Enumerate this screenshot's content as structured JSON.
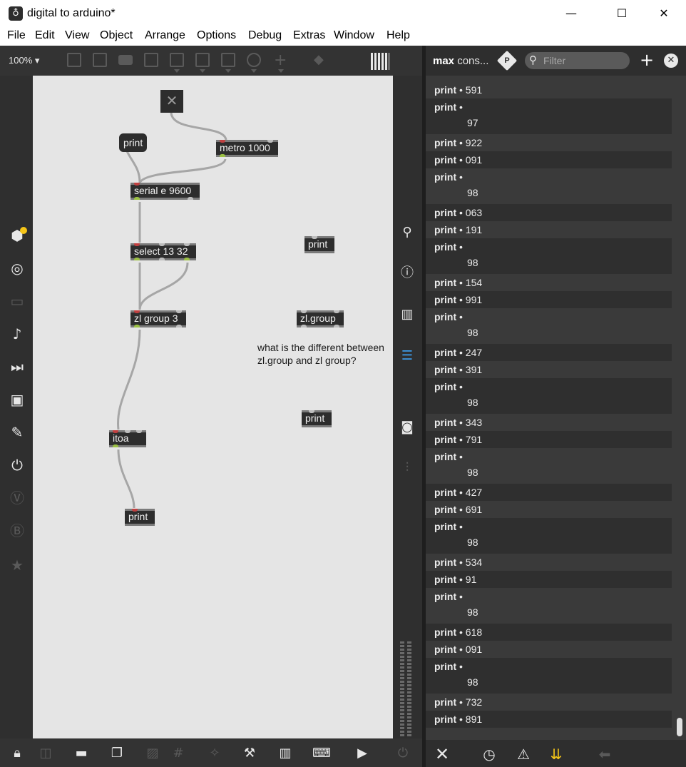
{
  "window": {
    "title": "digital to arduino*",
    "controls": {
      "minimize": "—",
      "maximize": "☐",
      "close": "✕"
    }
  },
  "menu": [
    "File",
    "Edit",
    "View",
    "Object",
    "Arrange",
    "Options",
    "Debug",
    "Extras",
    "Window",
    "Help"
  ],
  "toolbar": {
    "zoom": "100% ▾"
  },
  "patcher": {
    "objects": {
      "metro": "metro 1000",
      "serial": "serial e 9600",
      "select": "select 13 32",
      "zlgroup3": "zl group 3",
      "itoa": "itoa",
      "zlgroup": "zl.group"
    },
    "messages": {
      "print_msg": "print"
    },
    "print_objects": [
      "print",
      "print",
      "print"
    ],
    "comment": "what is the different between zl.group and zl group?"
  },
  "console": {
    "title_bold": "max",
    "title_rest": " cons...",
    "filter_placeholder": "Filter",
    "rows": [
      {
        "src": "print",
        "sep": " • ",
        "val": "591",
        "two": false
      },
      {
        "src": "print",
        "sep": " •",
        "val": "97",
        "two": true
      },
      {
        "src": "print",
        "sep": " • ",
        "val": "922",
        "two": false
      },
      {
        "src": "print",
        "sep": " • ",
        "val": "091",
        "two": false
      },
      {
        "src": "print",
        "sep": " •",
        "val": "98",
        "two": true
      },
      {
        "src": "print",
        "sep": " • ",
        "val": "063",
        "two": false
      },
      {
        "src": "print",
        "sep": " • ",
        "val": "191",
        "two": false
      },
      {
        "src": "print",
        "sep": " •",
        "val": "98",
        "two": true
      },
      {
        "src": "print",
        "sep": " • ",
        "val": "154",
        "two": false
      },
      {
        "src": "print",
        "sep": " • ",
        "val": "991",
        "two": false
      },
      {
        "src": "print",
        "sep": " •",
        "val": "98",
        "two": true
      },
      {
        "src": "print",
        "sep": " • ",
        "val": "247",
        "two": false
      },
      {
        "src": "print",
        "sep": " • ",
        "val": "391",
        "two": false
      },
      {
        "src": "print",
        "sep": " •",
        "val": "98",
        "two": true
      },
      {
        "src": "print",
        "sep": " • ",
        "val": "343",
        "two": false
      },
      {
        "src": "print",
        "sep": " • ",
        "val": "791",
        "two": false
      },
      {
        "src": "print",
        "sep": " •",
        "val": "98",
        "two": true
      },
      {
        "src": "print",
        "sep": " • ",
        "val": "427",
        "two": false
      },
      {
        "src": "print",
        "sep": " • ",
        "val": "691",
        "two": false
      },
      {
        "src": "print",
        "sep": " •",
        "val": "98",
        "two": true
      },
      {
        "src": "print",
        "sep": " • ",
        "val": "534",
        "two": false
      },
      {
        "src": "print",
        "sep": " • ",
        "val": "91",
        "two": false
      },
      {
        "src": "print",
        "sep": " •",
        "val": "98",
        "two": true
      },
      {
        "src": "print",
        "sep": " • ",
        "val": "618",
        "two": false
      },
      {
        "src": "print",
        "sep": " • ",
        "val": "091",
        "two": false
      },
      {
        "src": "print",
        "sep": " •",
        "val": "98",
        "two": true
      },
      {
        "src": "print",
        "sep": " • ",
        "val": "732",
        "two": false
      },
      {
        "src": "print",
        "sep": " • ",
        "val": "891",
        "two": false
      }
    ]
  },
  "colors": {
    "canvas": "#e5e5e5",
    "object": "#2d2d2d",
    "inlet": "#c04040",
    "outlet": "#9bc043",
    "accent_blue": "#3d9be9",
    "accent_yellow": "#f5c518"
  },
  "icons": {
    "left_sidebar": [
      "packages-icon",
      "target-icon",
      "media-icon",
      "music-note-icon",
      "video-icon",
      "image-icon",
      "paperclip-icon",
      "plug-icon",
      "vizzie-icon",
      "beap-icon",
      "star-icon"
    ],
    "right_strip": [
      "search-icon",
      "info-icon",
      "book-icon",
      "console-list-icon",
      "snapshot-icon",
      "mixer-icon"
    ],
    "bottom": [
      "lock-icon",
      "presentation-icon",
      "screen-icon",
      "windows-icon",
      "grid-icon",
      "tools-icon",
      "wrench-icon",
      "keyboard-icon",
      "piano-icon",
      "play-icon",
      "power-icon"
    ],
    "console_footer": [
      "clear-icon",
      "clock-icon",
      "warning-icon",
      "scroll-down-icon",
      "back-arrow-icon"
    ]
  }
}
